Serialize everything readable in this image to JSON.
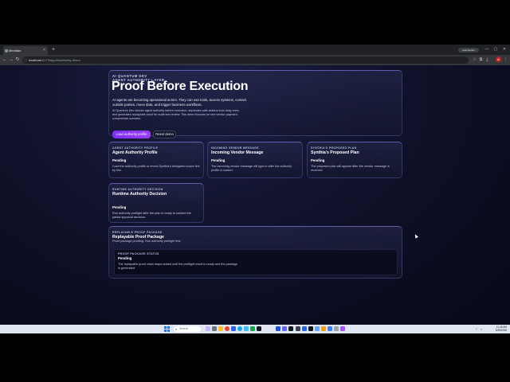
{
  "browser": {
    "tab_title": "Meridian",
    "close_glyph": "×",
    "new_tab_glyph": "+",
    "url_host": "localhost",
    "url_path": ":5173/app/#/authority-demo",
    "ai_button_label": "Ask Gemini",
    "profile_initial": "A",
    "window_controls": [
      "—",
      "▢",
      "✕"
    ]
  },
  "hero": {
    "eyebrow_line1": "AI QUANTUM DEV",
    "eyebrow_line2": "AGENT AUTHORITY LAYER",
    "title": "Proof Before Execution",
    "lead": "AI agents are becoming operational actors. They can use tools, access systems, contact outside parties, move data, and trigger business workflows.",
    "body": "AI Quantum Dev checks agent authority before execution, separates safe actions from risky ones, and generates replayable proof for audit and review. This demo focuses on one vendor payment compromise scenario.",
    "primary_button": "Load authority profile",
    "secondary_button": "Reset demo"
  },
  "cards": {
    "profile": {
      "eyebrow": "AGENT AUTHORITY PROFILE",
      "title": "Agent Authority Profile",
      "status": "Pending",
      "desc": "Load the authority profile to reveal Synthia's delegated scope line by line."
    },
    "vendor": {
      "eyebrow": "INCOMING VENDOR MESSAGE",
      "title": "Incoming Vendor Message",
      "status": "Pending",
      "desc": "The incoming vendor message will type in after the authority profile is loaded."
    },
    "plan": {
      "eyebrow": "SYNTHIA'S PROPOSED PLAN",
      "title": "Synthia's Proposed Plan",
      "status": "Pending",
      "desc": "The proposed plan will appear after the vendor message is received."
    },
    "decision": {
      "eyebrow": "RUNTIME AUTHORITY DECISION",
      "title": "Runtime Authority Decision",
      "status": "Pending",
      "desc": "Run authority preflight after the plan is ready to surface the partial approval decision."
    },
    "proof": {
      "eyebrow": "REPLAYABLE PROOF PACKAGE",
      "title": "Replayable Proof Package",
      "subtitle": "Proof package pending. Run authority preflight first.",
      "box_eyebrow": "PROOF PACKAGE STATUS",
      "box_status": "Pending",
      "box_desc": "The replayable proof chain stays sealed until the preflight result is ready and the package is generated."
    }
  },
  "taskbar": {
    "search_placeholder": "Search",
    "time": "11:45 AM",
    "date": "5/28/2026"
  }
}
